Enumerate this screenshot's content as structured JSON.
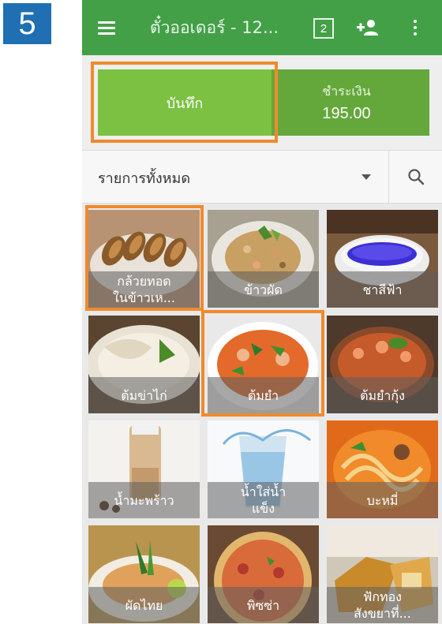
{
  "step_number": "5",
  "appbar": {
    "title": "ตั๋วออเดอร์ - 12...",
    "badge_count": "2",
    "icons": [
      "menu-icon",
      "add-person-icon",
      "more-vert-icon"
    ],
    "color": "#43a047"
  },
  "actions": {
    "save_label": "บันทึก",
    "pay_label": "ชำระเงิน",
    "pay_amount": "195.00"
  },
  "filter": {
    "category": "รายการทั้งหมด",
    "icons": [
      "dropdown-caret-icon",
      "search-icon"
    ]
  },
  "highlight_color": "#f08a2c",
  "menu_items": [
    {
      "name": "กล้วยทอดในข้าวเห...",
      "line1": "กล้วยทอด",
      "line2": "ในข้าวเห...",
      "highlighted": true
    },
    {
      "name": "ข้าวผัด",
      "line1": "ข้าวผัด",
      "line2": "",
      "highlighted": false
    },
    {
      "name": "ชาสีฟ้า",
      "line1": "ชาสีฟ้า",
      "line2": "",
      "highlighted": false
    },
    {
      "name": "ต้มข่าไก่",
      "line1": "ต้มข่าไก่",
      "line2": "",
      "highlighted": false
    },
    {
      "name": "ต้มยำ",
      "line1": "ต้มยำ",
      "line2": "",
      "highlighted": true
    },
    {
      "name": "ต้มยำกุ้ง",
      "line1": "ต้มยำกุ้ง",
      "line2": "",
      "highlighted": false
    },
    {
      "name": "น้ำมะพร้าว",
      "line1": "น้ำมะพร้าว",
      "line2": "",
      "highlighted": false
    },
    {
      "name": "น้ำใส่น้ำแข็ง",
      "line1": "น้ำใส่น้ำ",
      "line2": "แข็ง",
      "highlighted": false
    },
    {
      "name": "บะหมี่",
      "line1": "บะหมี่",
      "line2": "",
      "highlighted": false
    },
    {
      "name": "ผัดไทย",
      "line1": "ผัดไทย",
      "line2": "",
      "highlighted": false
    },
    {
      "name": "พิซซ่า",
      "line1": "พิซซ่า",
      "line2": "",
      "highlighted": false
    },
    {
      "name": "ฟักทองสังขยาที่...",
      "line1": "ฟักทอง",
      "line2": "สังขยาที่...",
      "highlighted": false
    }
  ]
}
